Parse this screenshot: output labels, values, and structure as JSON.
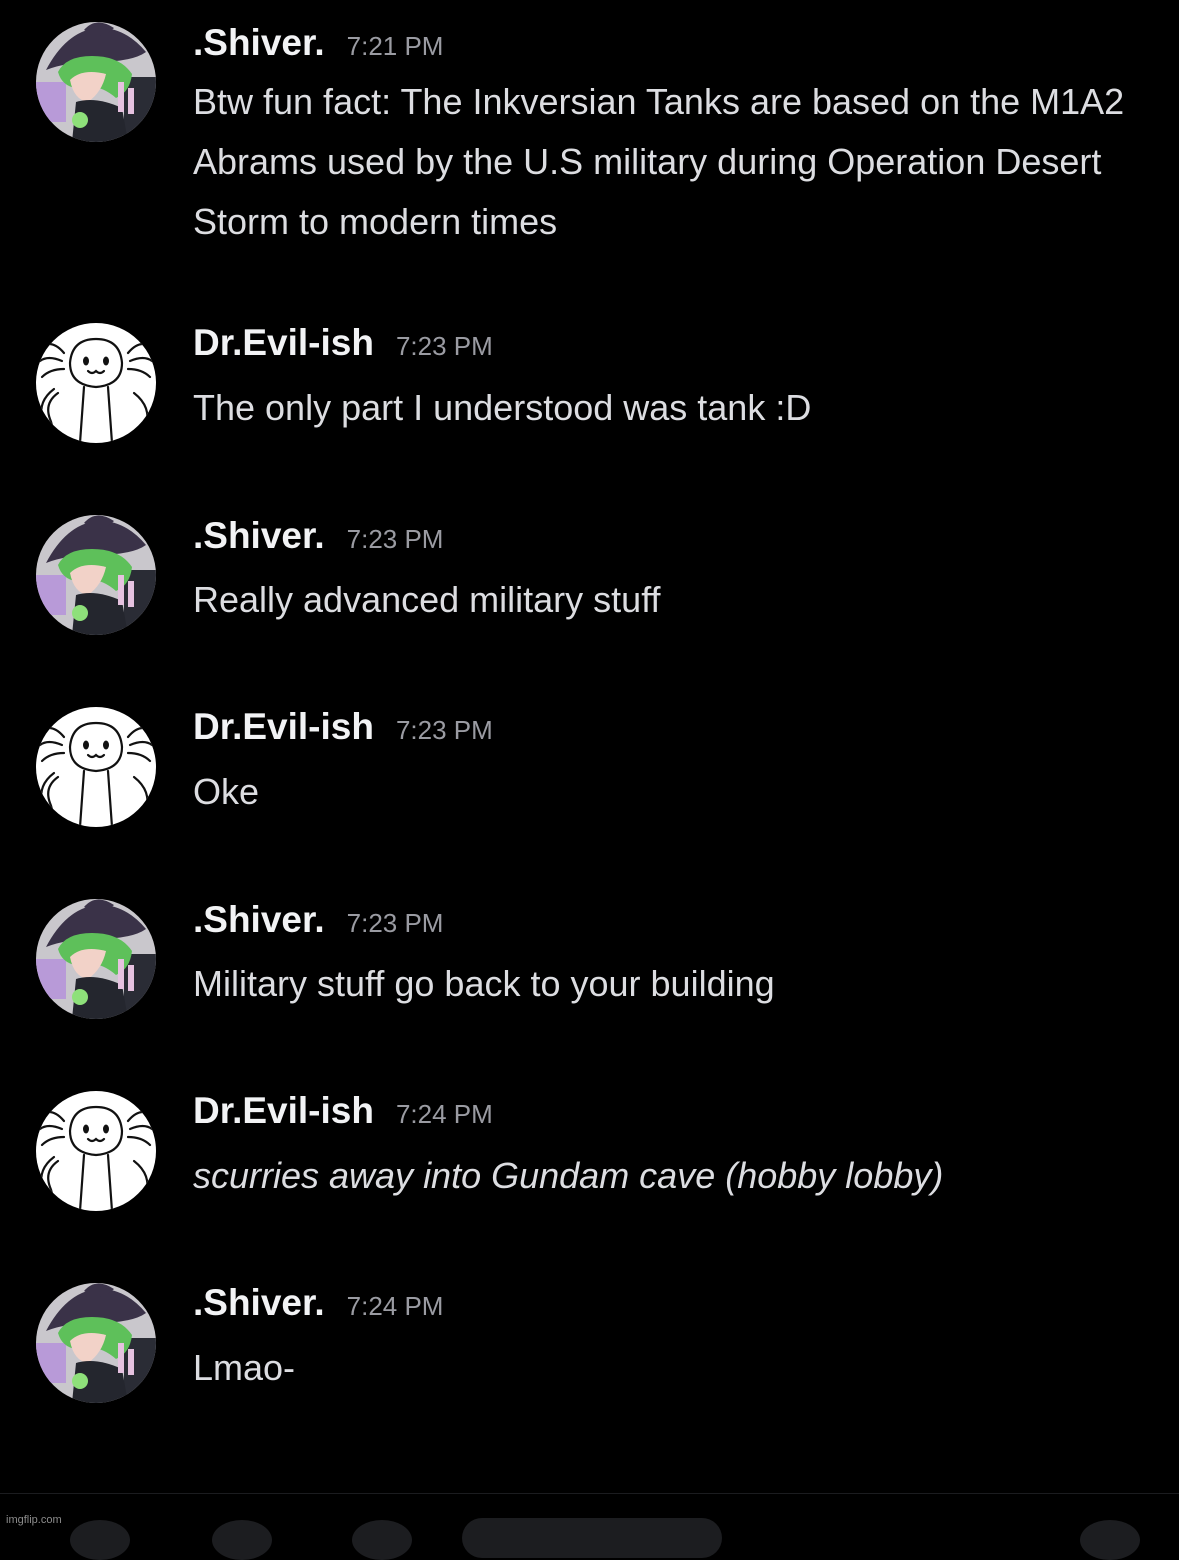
{
  "messages": [
    {
      "author": ".Shiver.",
      "time": "7:21 PM",
      "avatar_icon": "purple-witch-character-avatar-icon",
      "text": "Btw fun fact: The Inkversian Tanks are based on the M1A2 Abrams used by the U.S military during Operation Desert Storm to modern times",
      "italic": false
    },
    {
      "author": "Dr.Evil-ish",
      "time": "7:23 PM",
      "avatar_icon": "axolotl-sketch-avatar-icon",
      "text": "The only part I understood was tank :D",
      "italic": false
    },
    {
      "author": ".Shiver.",
      "time": "7:23 PM",
      "avatar_icon": "purple-witch-character-avatar-icon",
      "text": "Really advanced military stuff",
      "italic": false
    },
    {
      "author": "Dr.Evil-ish",
      "time": "7:23 PM",
      "avatar_icon": "axolotl-sketch-avatar-icon",
      "text": "Oke",
      "italic": false
    },
    {
      "author": ".Shiver.",
      "time": "7:23 PM",
      "avatar_icon": "purple-witch-character-avatar-icon",
      "text": "Military stuff go back to your building",
      "italic": false
    },
    {
      "author": "Dr.Evil-ish",
      "time": "7:24 PM",
      "avatar_icon": "axolotl-sketch-avatar-icon",
      "text": "scurries away into Gundam cave (hobby lobby)",
      "italic": true
    },
    {
      "author": ".Shiver.",
      "time": "7:24 PM",
      "avatar_icon": "purple-witch-character-avatar-icon",
      "text": "Lmao-",
      "italic": false
    }
  ],
  "watermark": "imgflip.com",
  "colors": {
    "background": "#000000",
    "author_name": "#f2f3f5",
    "timestamp": "#9a9ba2",
    "message_text": "#dcdde1"
  }
}
